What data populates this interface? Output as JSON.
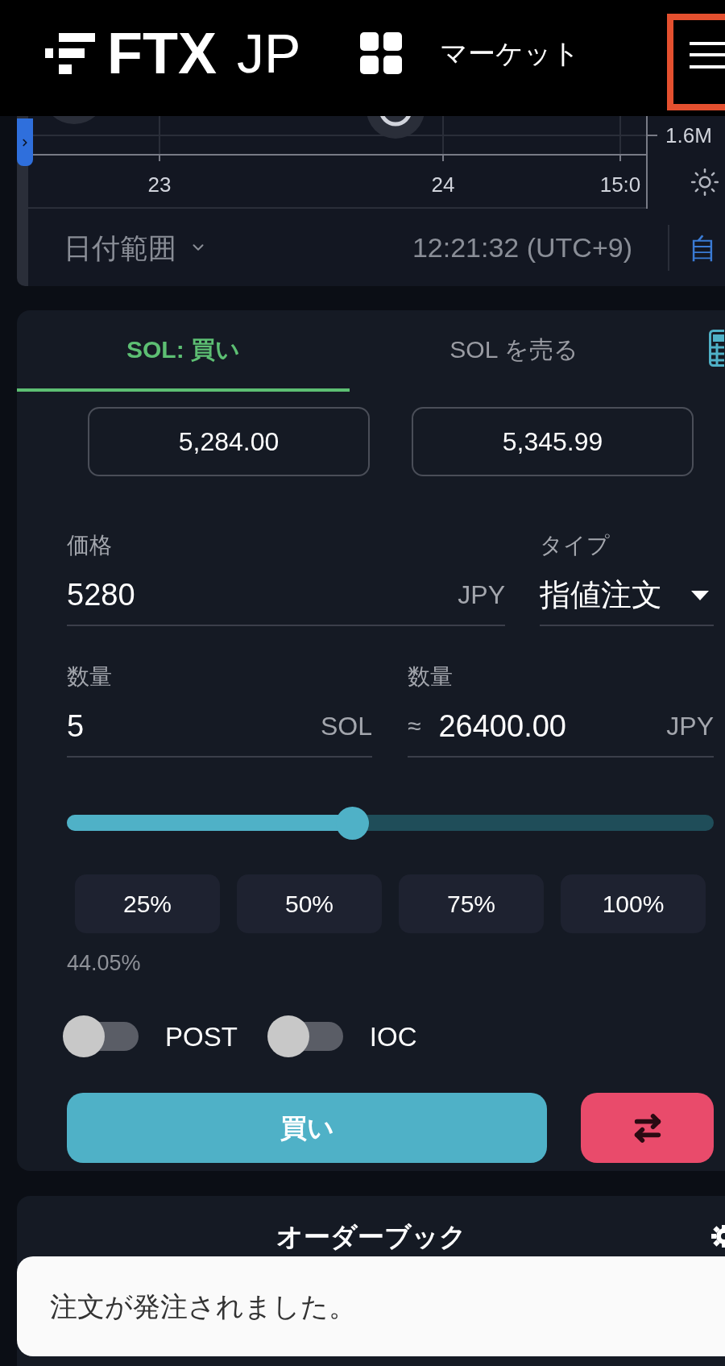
{
  "header": {
    "logo": {
      "name": "FTX",
      "suffix": "JP"
    },
    "nav": {
      "label": "マーケット"
    },
    "menu_button": {
      "highlighted": true
    }
  },
  "chart": {
    "volume_label": "1.6M",
    "time_ticks": [
      "23",
      "24",
      "15:0"
    ],
    "date_range": {
      "label": "日付範囲"
    },
    "clock": "12:21:32 (UTC+9)",
    "auto_label": "自"
  },
  "order_form": {
    "tabs": [
      {
        "label": "SOL: 買い",
        "selected": true
      },
      {
        "label": "SOL を売る",
        "selected": false
      }
    ],
    "quote_prices": [
      "5,284.00",
      "5,345.99"
    ],
    "price": {
      "label": "価格",
      "value": "5280",
      "unit": "JPY"
    },
    "type": {
      "label": "タイプ",
      "value": "指値注文"
    },
    "quantity": {
      "label": "数量",
      "value": "5",
      "unit": "SOL"
    },
    "total": {
      "label": "数量",
      "prefix": "≈",
      "value": "26400.00",
      "unit": "JPY"
    },
    "slider": {
      "level": 0.4405
    },
    "percent_buttons": [
      "25%",
      "50%",
      "75%",
      "100%"
    ],
    "percent_reading": "44.05%",
    "toggles": [
      {
        "label": "POST",
        "on": false
      },
      {
        "label": "IOC",
        "on": false
      }
    ],
    "submit": {
      "label": "買い"
    }
  },
  "order_book": {
    "title": "オーダーブック"
  },
  "toast": {
    "message": "注文が発注されました。"
  }
}
